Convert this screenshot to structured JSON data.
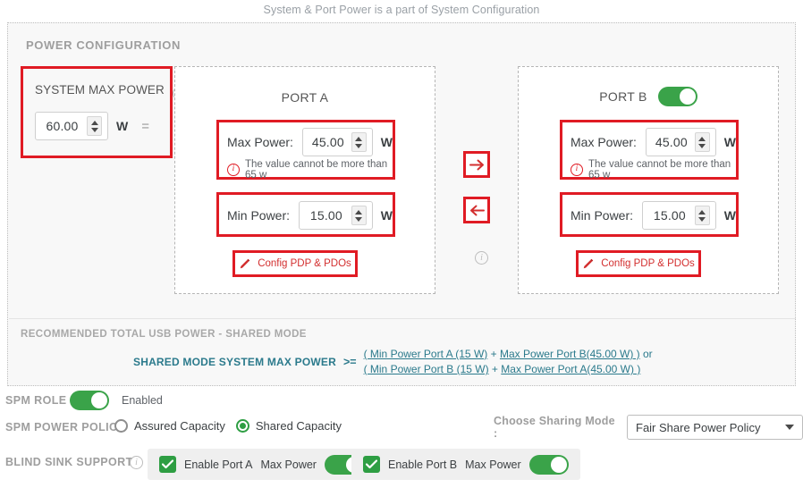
{
  "top_caption": "System & Port Power is a part of System Configuration",
  "panel": {
    "title": "POWER CONFIGURATION",
    "system_max_power": {
      "label": "SYSTEM MAX POWER",
      "info_icon": "info-icon",
      "value": "60.00",
      "unit": "W",
      "equals": "="
    },
    "middle": {
      "arrow_right_icon": "arrow-right-icon",
      "arrow_left_icon": "arrow-left-icon",
      "info_icon": "info-icon"
    },
    "ports": [
      {
        "id": "A",
        "title": "PORT A",
        "has_toggle": false,
        "max_power": {
          "label": "Max Power:",
          "value": "45.00",
          "unit": "W"
        },
        "max_hint": "The value cannot be more than 65 w",
        "min_power": {
          "label": "Min Power:",
          "value": "15.00",
          "unit": "W"
        },
        "config_button": "Config PDP & PDOs"
      },
      {
        "id": "B",
        "title": "PORT B",
        "has_toggle": true,
        "toggle_on": true,
        "max_power": {
          "label": "Max Power:",
          "value": "45.00",
          "unit": "W"
        },
        "max_hint": "The value cannot be more than 65 w",
        "min_power": {
          "label": "Min Power:",
          "value": "15.00",
          "unit": "W"
        },
        "config_button": "Config PDP & PDOs"
      }
    ],
    "recommended": {
      "title": "RECOMMENDED TOTAL USB POWER - SHARED MODE",
      "formula_label": "SHARED MODE SYSTEM MAX POWER",
      "operator": ">=",
      "line1_open": "( Min Power Port A (15 W)",
      "line1_plus": " + ",
      "line1_right": "Max Power Port B(45.00 W) )",
      "line1_suffix": " or",
      "line2_open": "( Min Power Port B (15 W)",
      "line2_plus": " + ",
      "line2_right": "Max Power Port A(45.00 W) )"
    }
  },
  "bottom": {
    "spm_role": {
      "label": "SPM ROLE",
      "state": "Enabled",
      "toggle_on": true
    },
    "spm_power_policy": {
      "label": "SPM POWER POLICY",
      "options": [
        {
          "label": "Assured Capacity",
          "selected": false
        },
        {
          "label": "Shared Capacity",
          "selected": true
        }
      ]
    },
    "sharing_mode": {
      "label": "Choose Sharing Mode :",
      "value": "Fair Share Power Policy",
      "chevron_icon": "chevron-down-icon"
    },
    "blind_sink_support": {
      "label": "BLIND SINK SUPPORT",
      "info_icon": "info-icon",
      "groups": [
        {
          "checkbox_label": "Enable Port A",
          "toggle_label": "Max Power",
          "checked": true,
          "toggle_on": true
        },
        {
          "checkbox_label": "Enable Port B",
          "toggle_label": "Max Power",
          "checked": true,
          "toggle_on": true
        }
      ]
    }
  },
  "colors": {
    "highlight_red": "#e01b24",
    "accent_green": "#3aa349",
    "teal_text": "#2b7a8c",
    "label_grey": "#9e9e9e"
  }
}
